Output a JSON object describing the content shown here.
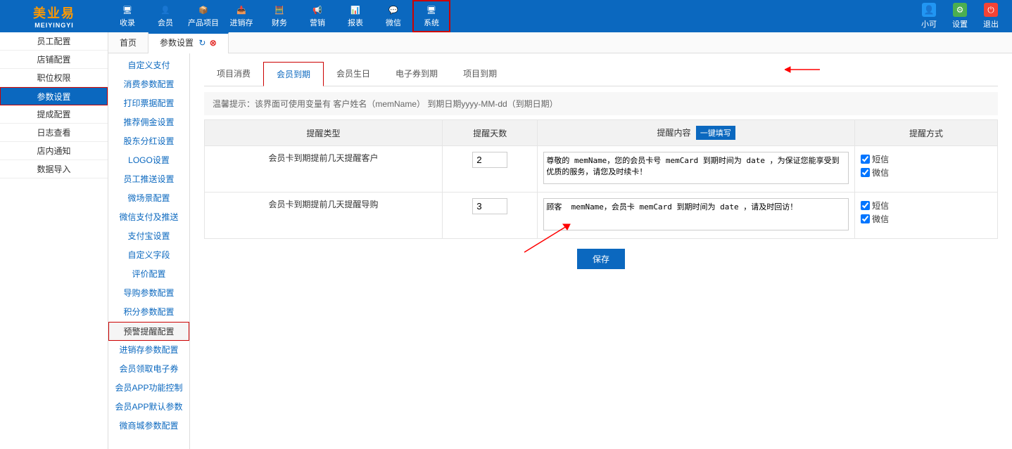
{
  "logo": {
    "main": "美业易",
    "sub": "MEIYINGYI"
  },
  "topnav": [
    {
      "label": "收录"
    },
    {
      "label": "会员"
    },
    {
      "label": "产品项目"
    },
    {
      "label": "进销存"
    },
    {
      "label": "财务"
    },
    {
      "label": "营销"
    },
    {
      "label": "报表"
    },
    {
      "label": "微信"
    },
    {
      "label": "系统"
    }
  ],
  "topright": [
    {
      "label": "小可"
    },
    {
      "label": "设置"
    },
    {
      "label": "退出"
    }
  ],
  "sidebar": [
    "员工配置",
    "店铺配置",
    "职位权限",
    "参数设置",
    "提成配置",
    "日志查看",
    "店内通知",
    "数据导入"
  ],
  "sidebar_active": 3,
  "tabs": {
    "home": "首页",
    "current": "参数设置"
  },
  "subsidebar": [
    "自定义支付",
    "消费参数配置",
    "打印票据配置",
    "推荐佣金设置",
    "股东分红设置",
    "LOGO设置",
    "员工推送设置",
    "微场景配置",
    "微信支付及推送",
    "支付宝设置",
    "自定义字段",
    "评价配置",
    "导购参数配置",
    "积分参数配置",
    "预警提醒配置",
    "进销存参数配置",
    "会员领取电子券",
    "会员APP功能控制",
    "会员APP默认参数",
    "微商城参数配置"
  ],
  "subsidebar_active": 14,
  "subtabs": [
    "项目消费",
    "会员到期",
    "会员生日",
    "电子券到期",
    "项目到期"
  ],
  "subtab_active": 1,
  "hint": "温馨提示：该界面可使用变量有 客户姓名（memName） 到期日期yyyy-MM-dd（到期日期）",
  "table": {
    "headers": [
      "提醒类型",
      "提醒天数",
      "提醒内容",
      "提醒方式"
    ],
    "fill_btn": "一键填写",
    "methods": [
      "短信",
      "微信"
    ],
    "rows": [
      {
        "type": "会员卡到期提前几天提醒客户",
        "days": "2",
        "content": "尊敬的 memName，您的会员卡号 memCard 到期时间为 date ，为保证您能享受到优质的服务，请您及时续卡！",
        "sms": true,
        "wechat": true
      },
      {
        "type": "会员卡到期提前几天提醒导购",
        "days": "3",
        "content": "顾客  memName，会员卡 memCard 到期时间为 date ，请及时回访！",
        "sms": true,
        "wechat": true
      }
    ]
  },
  "save_btn": "保存"
}
